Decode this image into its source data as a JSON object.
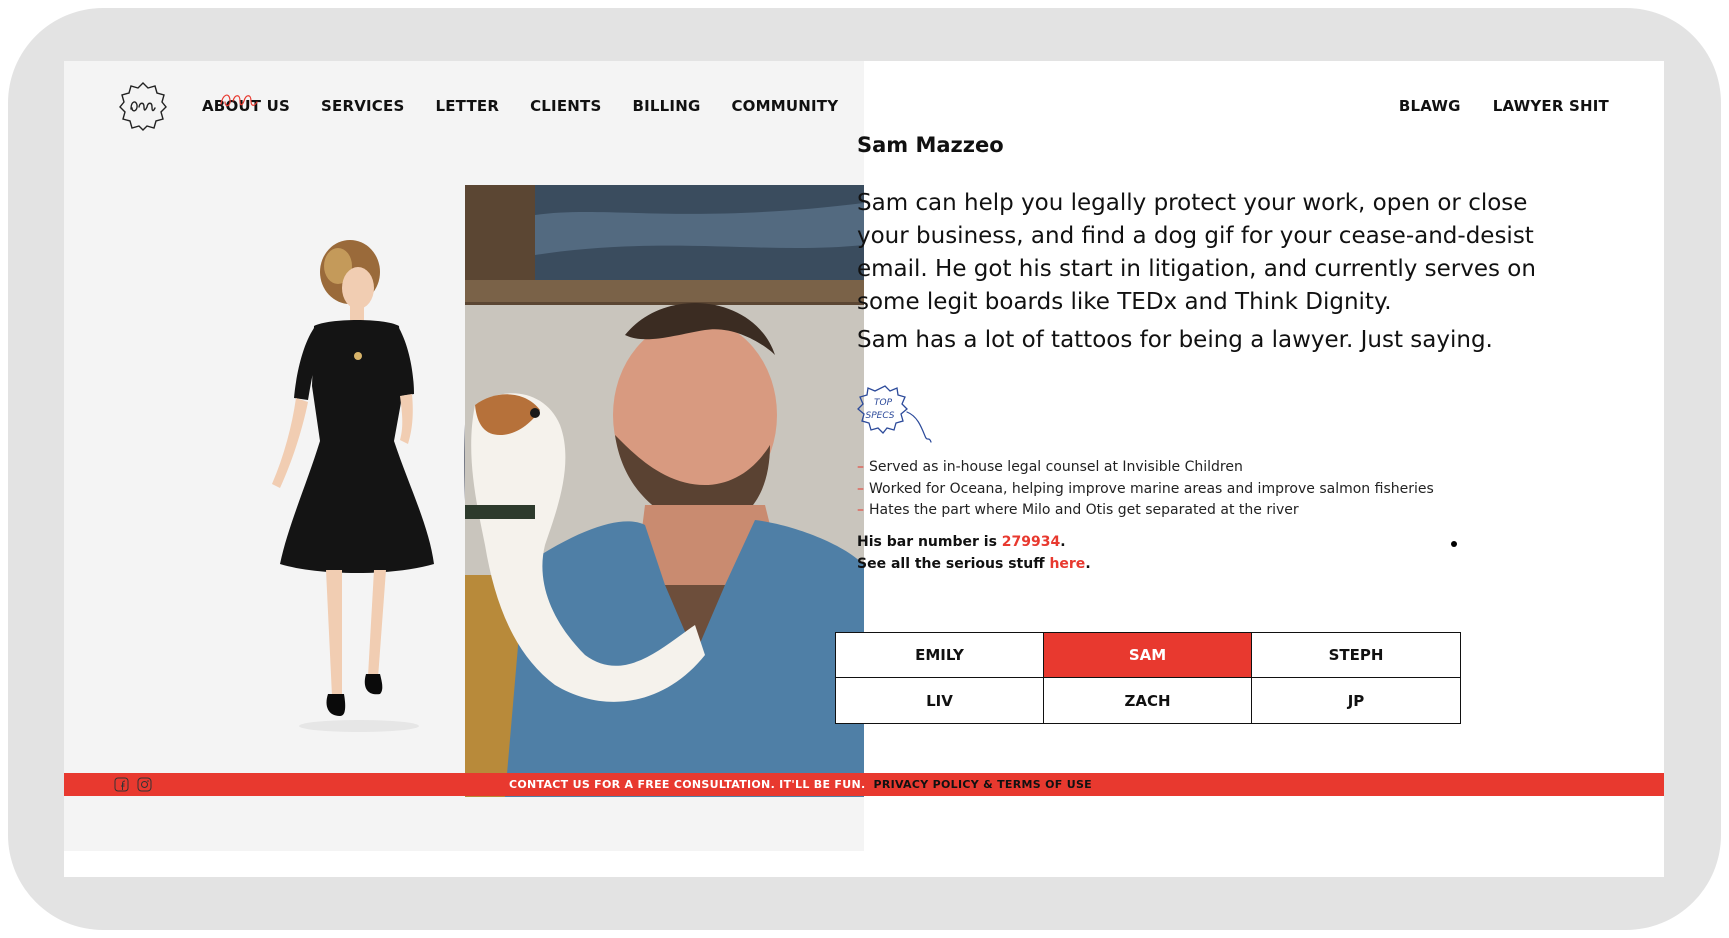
{
  "nav": {
    "left": [
      "ABOUT US",
      "SERVICES",
      "LETTER",
      "CLIENTS",
      "BILLING",
      "COMMUNITY"
    ],
    "right": [
      "BLAWG",
      "LAWYER SHIT"
    ]
  },
  "profile": {
    "name": "Sam Mazzeo",
    "bio": "Sam can help you legally protect your work, open or close your business, and find a dog gif for your cease-and-desist email. He got his start in litigation, and currently serves on some legit boards like TEDx and Think Dignity.",
    "bio2": "Sam has a lot of tattoos for being a lawyer. Just saying.",
    "badge_lines": [
      "TOP",
      "SPECS"
    ],
    "specs": [
      "Served as in-house legal counsel at Invisible Children",
      "Worked for Oceana, helping improve marine areas and improve salmon fisheries",
      "Hates the part where Milo and Otis get separated at the river"
    ],
    "bar_prefix": "His bar number is ",
    "bar_number": "279934",
    "bar_suffix": ".",
    "serious_prefix": "See all the serious stuff ",
    "serious_link": "here",
    "serious_suffix": "."
  },
  "team": {
    "members": [
      "EMILY",
      "SAM",
      "STEPH",
      "LIV",
      "ZACH",
      "JP"
    ],
    "active": "SAM"
  },
  "footer": {
    "contact": "CONTACT US FOR A FREE CONSULTATION. IT'LL BE FUN.",
    "privacy": "PRIVACY POLICY & TERMS OF USE",
    "icons": [
      "facebook-icon",
      "instagram-icon"
    ]
  },
  "colors": {
    "accent": "#e8392f",
    "frame": "#e3e3e3",
    "text": "#111111"
  }
}
